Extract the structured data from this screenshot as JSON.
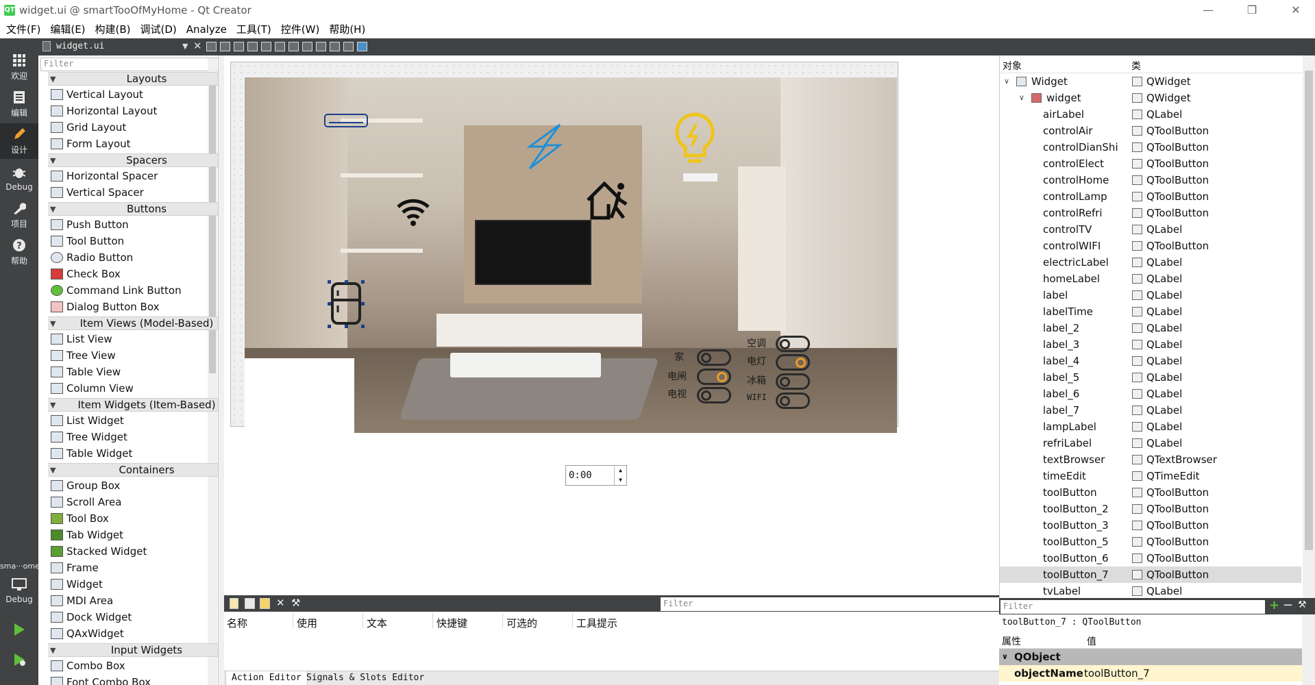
{
  "window": {
    "title": "widget.ui @ smartTooOfMyHome - Qt Creator",
    "logo": "QT"
  },
  "menubar": [
    "文件(F)",
    "编辑(E)",
    "构建(B)",
    "调试(D)",
    "Analyze",
    "工具(T)",
    "控件(W)",
    "帮助(H)"
  ],
  "modes": [
    {
      "label": "欢迎",
      "icon": "grid-icon"
    },
    {
      "label": "编辑",
      "icon": "document-icon"
    },
    {
      "label": "设计",
      "icon": "pencil-icon"
    },
    {
      "label": "Debug",
      "icon": "bug-icon"
    },
    {
      "label": "项目",
      "icon": "wrench-icon"
    },
    {
      "label": "帮助",
      "icon": "help-icon"
    }
  ],
  "kit": {
    "project": "sma···ome",
    "label": "Debug"
  },
  "editor": {
    "file_name": "widget.ui"
  },
  "widgetbox": {
    "filter_placeholder": "Filter",
    "categories": [
      {
        "name": "Layouts",
        "items": [
          "Vertical Layout",
          "Horizontal Layout",
          "Grid Layout",
          "Form Layout"
        ]
      },
      {
        "name": "Spacers",
        "items": [
          "Horizontal Spacer",
          "Vertical Spacer"
        ]
      },
      {
        "name": "Buttons",
        "items": [
          "Push Button",
          "Tool Button",
          "Radio Button",
          "Check Box",
          "Command Link Button",
          "Dialog Button Box"
        ]
      },
      {
        "name": "Item Views (Model-Based)",
        "items": [
          "List View",
          "Tree View",
          "Table View",
          "Column View"
        ]
      },
      {
        "name": "Item Widgets (Item-Based)",
        "items": [
          "List Widget",
          "Tree Widget",
          "Table Widget"
        ]
      },
      {
        "name": "Containers",
        "items": [
          "Group Box",
          "Scroll Area",
          "Tool Box",
          "Tab Widget",
          "Stacked Widget",
          "Frame",
          "Widget",
          "MDI Area",
          "Dock Widget",
          "QAxWidget"
        ]
      },
      {
        "name": "Input Widgets",
        "items": [
          "Combo Box",
          "Font Combo Box"
        ]
      }
    ]
  },
  "form": {
    "labels_left": [
      "家",
      "电闸",
      "电视"
    ],
    "labels_right": [
      "空调",
      "电灯",
      "冰箱",
      "WIFI"
    ],
    "toggles_left_on": [
      false,
      true,
      false
    ],
    "toggles_right_on": [
      false,
      true,
      false,
      false
    ],
    "time_value": "0:00",
    "accent_color": "#f0c419",
    "flash_color": "#1f8fd8"
  },
  "action_editor": {
    "filter_placeholder": "Filter",
    "columns": [
      "名称",
      "使用",
      "文本",
      "快捷键",
      "可选的",
      "工具提示"
    ],
    "tabs": [
      "Action Editor",
      "Signals & Slots Editor"
    ]
  },
  "object_inspector": {
    "columns": [
      "对象",
      "类"
    ],
    "root": {
      "name": "Widget",
      "class": "QWidget"
    },
    "child": {
      "name": "widget",
      "class": "QWidget"
    },
    "items": [
      {
        "name": "airLabel",
        "class": "QLabel"
      },
      {
        "name": "controlAir",
        "class": "QToolButton"
      },
      {
        "name": "controlDianShi",
        "class": "QToolButton"
      },
      {
        "name": "controlElect",
        "class": "QToolButton"
      },
      {
        "name": "controlHome",
        "class": "QToolButton"
      },
      {
        "name": "controlLamp",
        "class": "QToolButton"
      },
      {
        "name": "controlRefri",
        "class": "QToolButton"
      },
      {
        "name": "controlTV",
        "class": "QLabel"
      },
      {
        "name": "controlWIFI",
        "class": "QToolButton"
      },
      {
        "name": "electricLabel",
        "class": "QLabel"
      },
      {
        "name": "homeLabel",
        "class": "QLabel"
      },
      {
        "name": "label",
        "class": "QLabel"
      },
      {
        "name": "labelTime",
        "class": "QLabel"
      },
      {
        "name": "label_2",
        "class": "QLabel"
      },
      {
        "name": "label_3",
        "class": "QLabel"
      },
      {
        "name": "label_4",
        "class": "QLabel"
      },
      {
        "name": "label_5",
        "class": "QLabel"
      },
      {
        "name": "label_6",
        "class": "QLabel"
      },
      {
        "name": "label_7",
        "class": "QLabel"
      },
      {
        "name": "lampLabel",
        "class": "QLabel"
      },
      {
        "name": "refriLabel",
        "class": "QLabel"
      },
      {
        "name": "textBrowser",
        "class": "QTextBrowser"
      },
      {
        "name": "timeEdit",
        "class": "QTimeEdit"
      },
      {
        "name": "toolButton",
        "class": "QToolButton"
      },
      {
        "name": "toolButton_2",
        "class": "QToolButton"
      },
      {
        "name": "toolButton_3",
        "class": "QToolButton"
      },
      {
        "name": "toolButton_5",
        "class": "QToolButton"
      },
      {
        "name": "toolButton_6",
        "class": "QToolButton"
      },
      {
        "name": "toolButton_7",
        "class": "QToolButton",
        "selected": true
      },
      {
        "name": "tvLabel",
        "class": "QLabel"
      }
    ]
  },
  "property_editor": {
    "filter_placeholder": "Filter",
    "object_line": "toolButton_7 : QToolButton",
    "columns": [
      "属性",
      "值"
    ],
    "group": "QObject",
    "property": {
      "name": "objectName",
      "value": "toolButton_7"
    }
  }
}
